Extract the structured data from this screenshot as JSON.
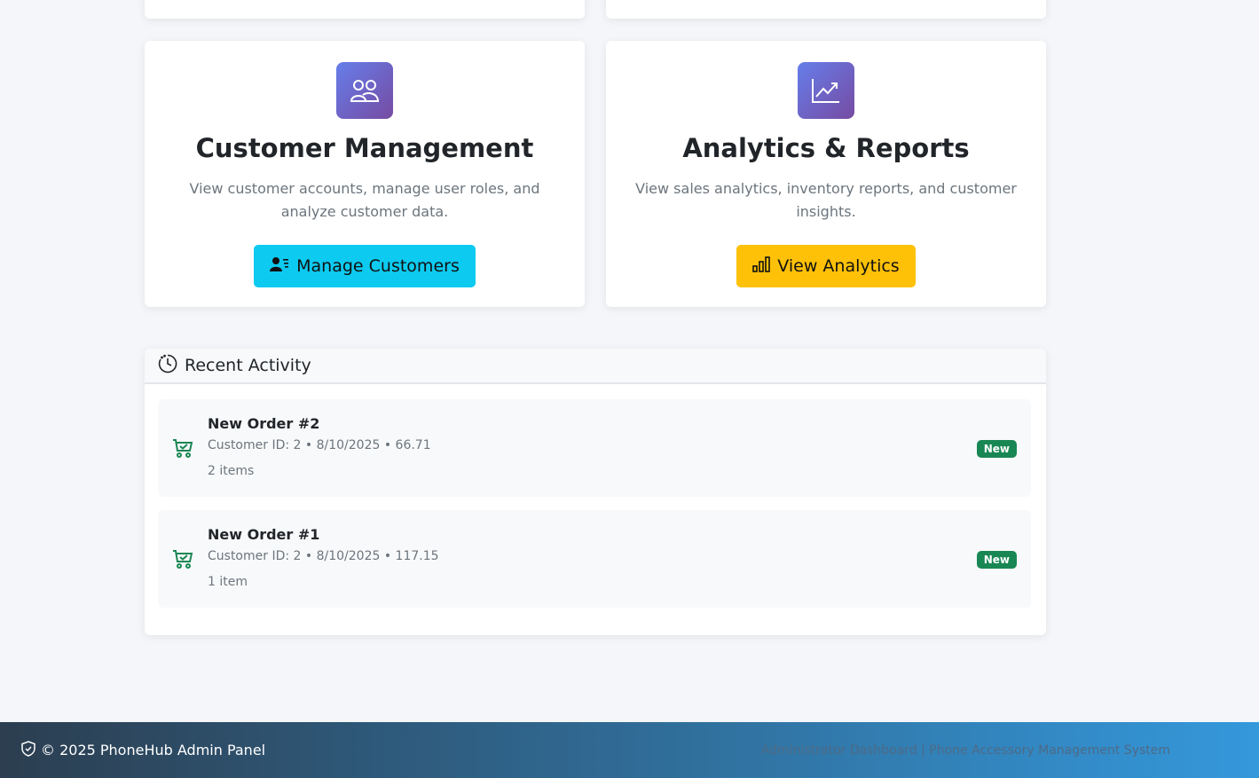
{
  "cards": [
    {
      "icon": "people-icon",
      "title": "Customer Management",
      "description": "View customer accounts, manage user roles, and analyze customer data.",
      "button_label": "Manage Customers",
      "button_icon": "user-list-icon",
      "button_color": "#0dcaf0"
    },
    {
      "icon": "graph-up-icon",
      "title": "Analytics & Reports",
      "description": "View sales analytics, inventory reports, and customer insights.",
      "button_label": "View Analytics",
      "button_icon": "bar-chart-icon",
      "button_color": "#ffc107"
    }
  ],
  "activity": {
    "title": "Recent Activity",
    "items": [
      {
        "title": "New Order #2",
        "meta": "Customer ID: 2 • 8/10/2025 • 66.71",
        "count": "2 items",
        "badge": "New"
      },
      {
        "title": "New Order #1",
        "meta": "Customer ID: 2 • 8/10/2025 • 117.15",
        "count": "1 item",
        "badge": "New"
      }
    ]
  },
  "footer": {
    "copyright": "© 2025 PhoneHub Admin Panel",
    "tagline": "Administrator Dashboard | Phone Accessory Management System"
  },
  "colors": {
    "accent_gradient_start": "#667eea",
    "accent_gradient_end": "#764ba2",
    "badge_green": "#198754",
    "cart_green": "#198754",
    "footer_start": "#2c3e50",
    "footer_end": "#3498db"
  }
}
